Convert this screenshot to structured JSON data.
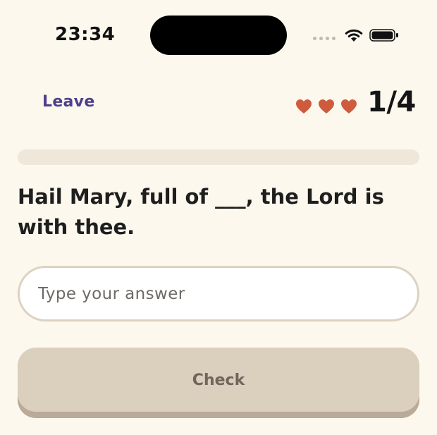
{
  "status_bar": {
    "time": "23:34",
    "wifi_icon": "wifi-icon",
    "battery_icon": "battery-icon",
    "signal_icon": "signal-dots-icon"
  },
  "header": {
    "leave_label": "Leave",
    "hearts_remaining": 3,
    "heart_color": "#cf5b3f",
    "progress_label": "1/4"
  },
  "progress": {
    "fraction": 0
  },
  "quiz": {
    "question": "Hail Mary, full of ___, the Lord is with thee.",
    "answer_placeholder": "Type your answer",
    "answer_value": "",
    "check_label": "Check"
  },
  "colors": {
    "background": "#fcf8ee",
    "accent": "#4e3f8c",
    "check_button": "#dbcfbe",
    "progress_track": "#efe8da"
  }
}
